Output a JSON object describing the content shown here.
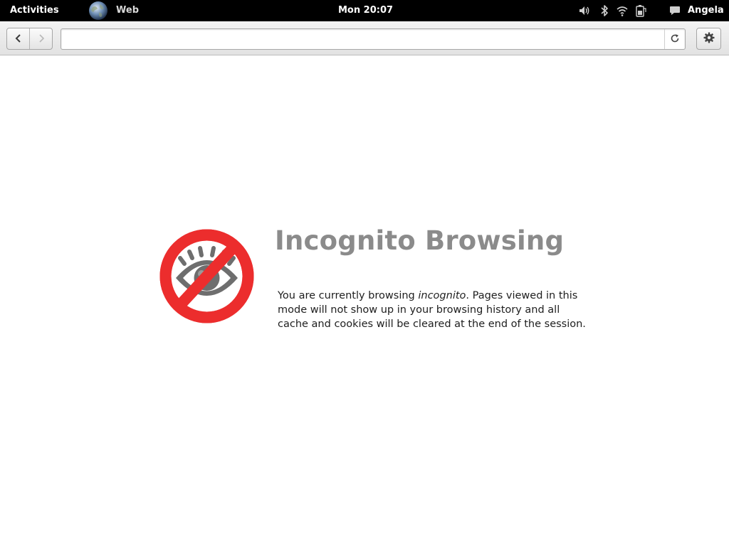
{
  "top_panel": {
    "activities_label": "Activities",
    "app_name": "Web",
    "clock": "Mon 20:07",
    "user_name": "Angela",
    "tray_icons": [
      "volume-icon",
      "bluetooth-icon",
      "wifi-icon",
      "battery-icon",
      "chat-icon"
    ]
  },
  "toolbar": {
    "back_icon": "back-arrow-icon",
    "forward_icon": "forward-arrow-icon",
    "url_value": "",
    "reload_icon": "reload-icon",
    "menu_icon": "gear-icon"
  },
  "incognito": {
    "title": "Incognito Browsing",
    "text_before": "You are currently browsing ",
    "text_italic": "incognito",
    "text_after": ". Pages viewed in this mode will not show up in your browsing history and all cache and cookies will be cleared at the end of the session.",
    "icon": "incognito-eye-icon"
  },
  "colors": {
    "panel_bg": "#000000",
    "prohibition_red": "#ec2d2d",
    "eye_gray": "#6e6e6e",
    "title_gray": "#8b8b8b"
  }
}
